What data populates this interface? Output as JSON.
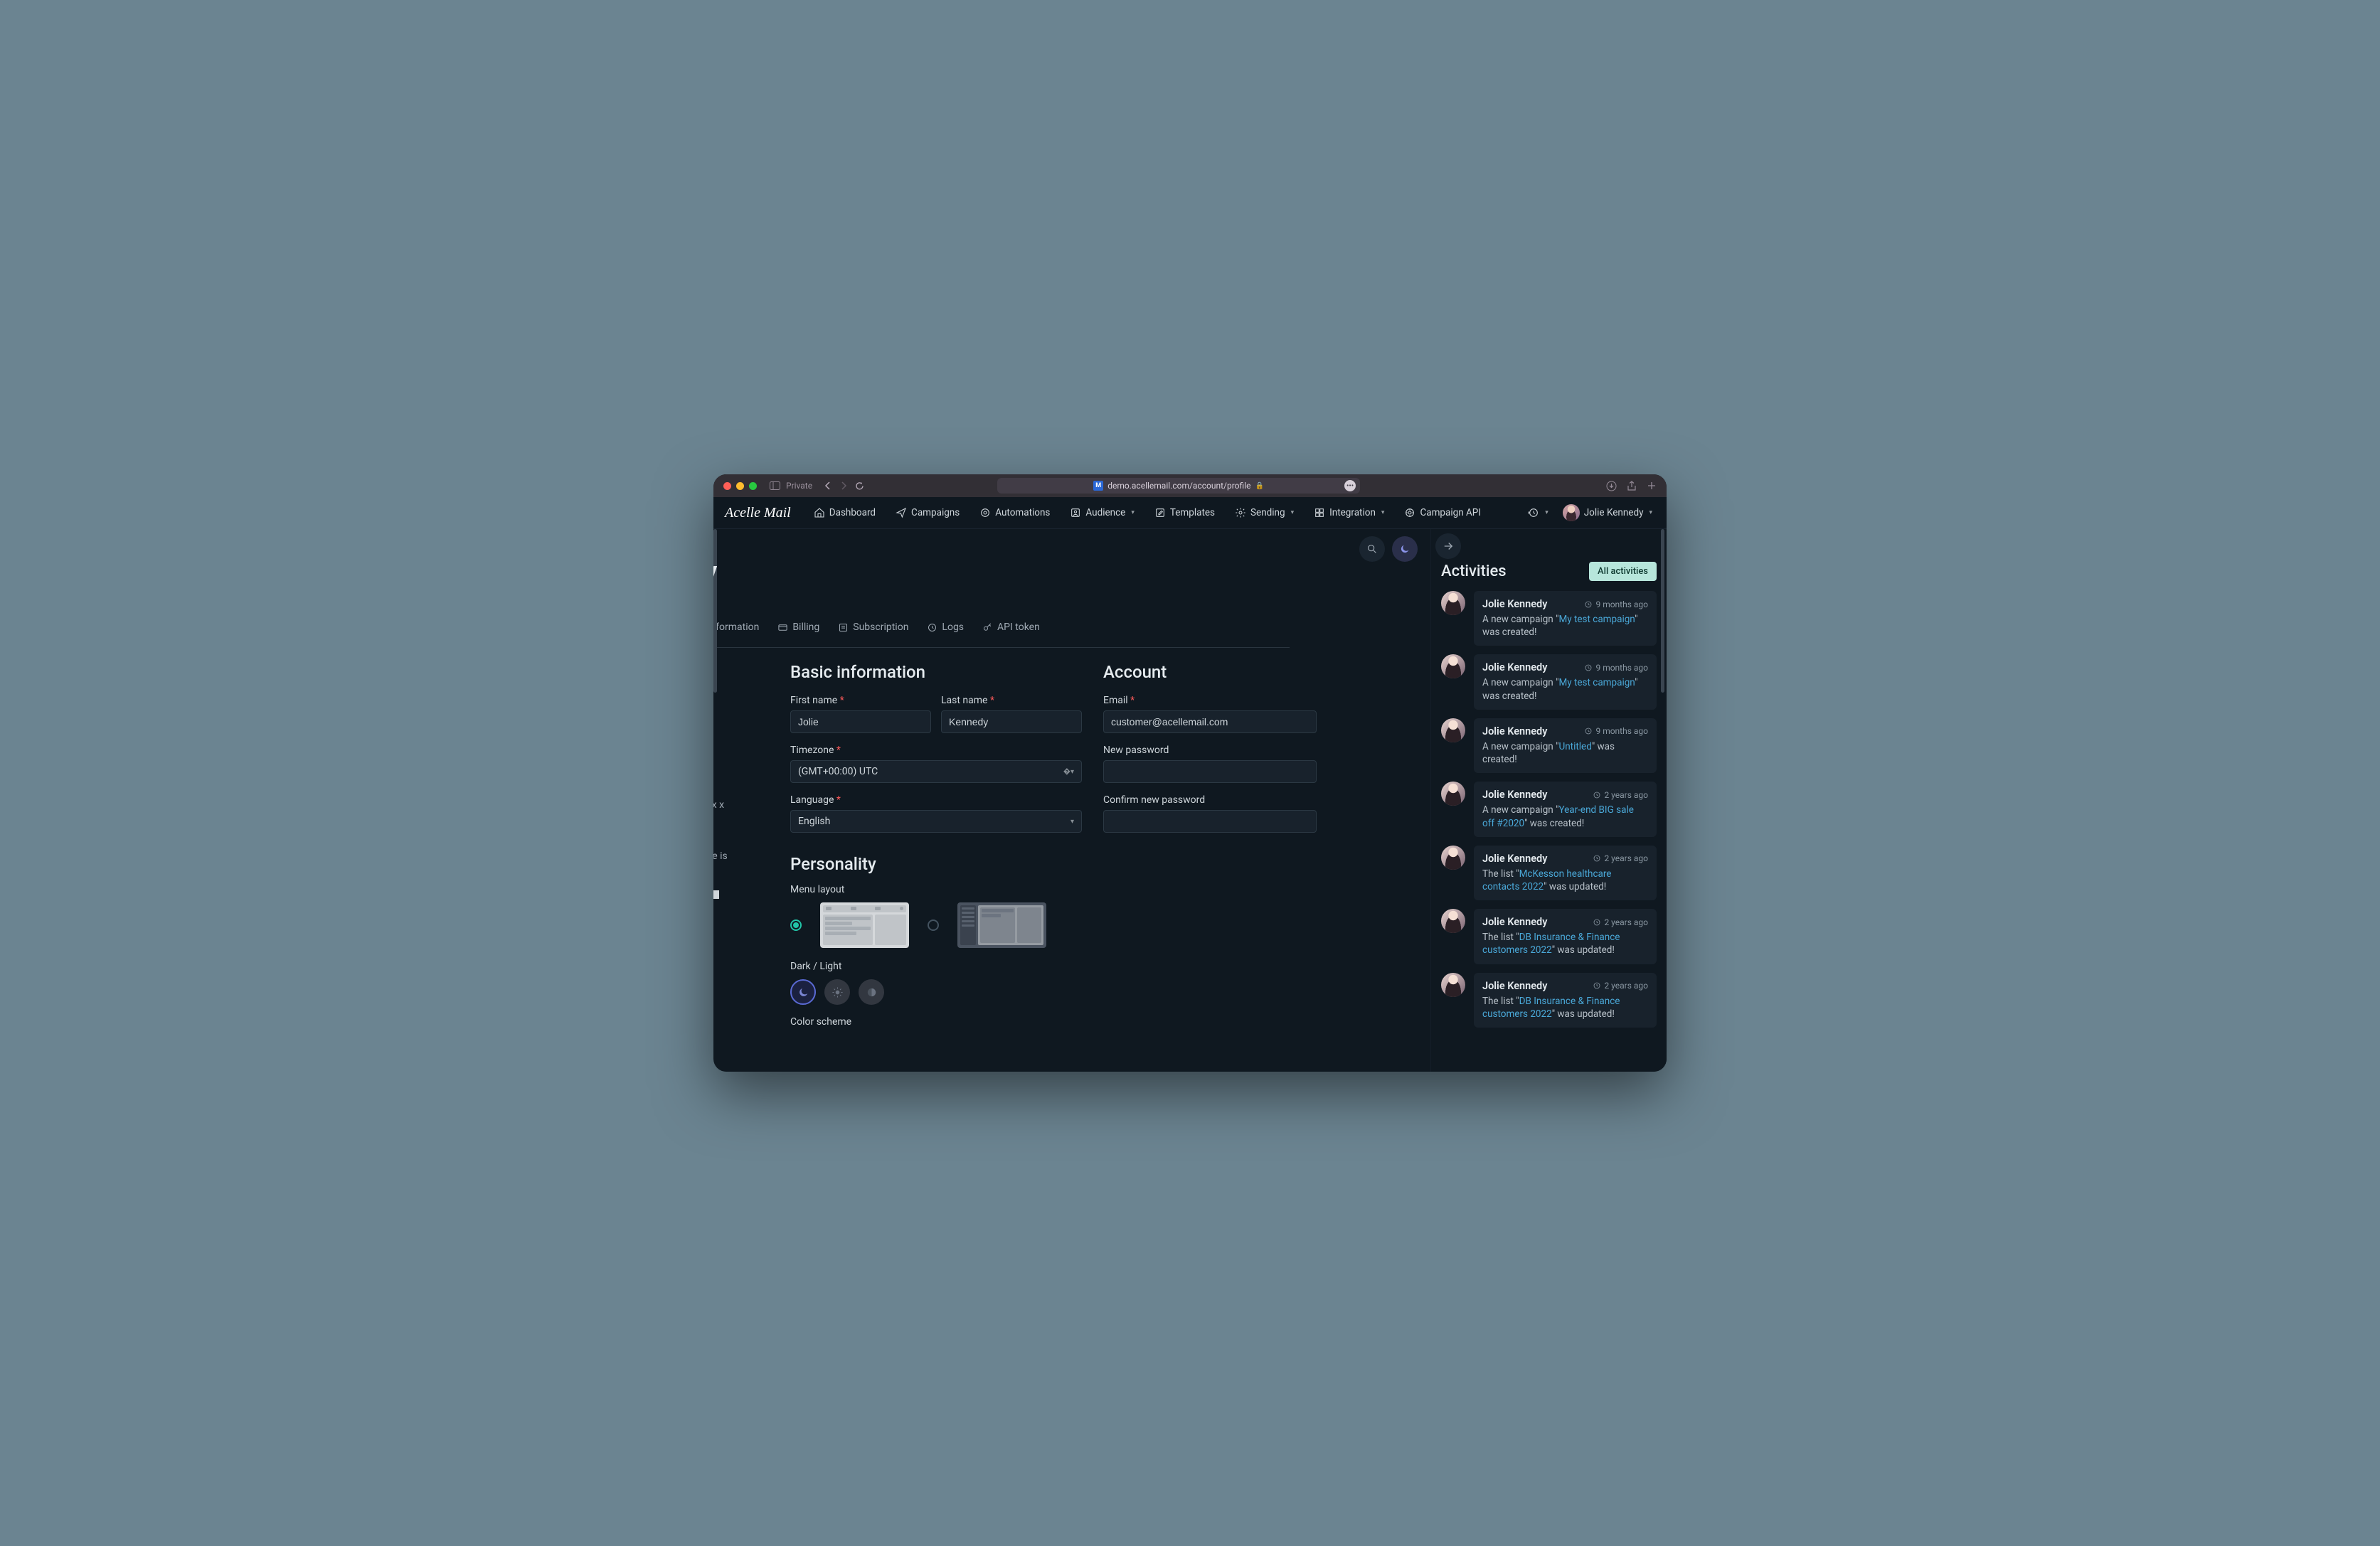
{
  "browser": {
    "private_label": "Private",
    "url": "demo.acellemail.com/account/profile",
    "favicon_letter": "M"
  },
  "brand": {
    "name": "Acelle",
    "suffix": "Mail"
  },
  "nav": {
    "dashboard": "Dashboard",
    "campaigns": "Campaigns",
    "automations": "Automations",
    "audience": "Audience",
    "templates": "Templates",
    "sending": "Sending",
    "integration": "Integration",
    "campaign_api": "Campaign API"
  },
  "user": {
    "name": "Jolie Kennedy"
  },
  "page": {
    "partial_title": "edy"
  },
  "tabs": {
    "information": "information",
    "billing": "Billing",
    "subscription": "Subscription",
    "logs": "Logs",
    "api_token": "API token"
  },
  "form": {
    "basic_heading": "Basic information",
    "account_heading": "Account",
    "first_name_label": "First name",
    "first_name_value": "Jolie",
    "last_name_label": "Last name",
    "last_name_value": "Kennedy",
    "timezone_label": "Timezone",
    "timezone_value": "(GMT+00:00) UTC",
    "language_label": "Language",
    "language_value": "English",
    "email_label": "Email",
    "email_value": "customer@acellemail.com",
    "new_password_label": "New password",
    "confirm_password_label": "Confirm new password"
  },
  "cropped": {
    "px_x": "px x",
    "ize_is": "ize is"
  },
  "personality": {
    "heading": "Personality",
    "menu_layout_label": "Menu layout",
    "dark_light_label": "Dark / Light",
    "color_scheme_label": "Color scheme"
  },
  "activities": {
    "heading": "Activities",
    "all_button": "All activities",
    "items": [
      {
        "name": "Jolie Kennedy",
        "time": "9 months ago",
        "prefix": "A new campaign \"",
        "link": "My test campaign",
        "suffix": "\" was created!"
      },
      {
        "name": "Jolie Kennedy",
        "time": "9 months ago",
        "prefix": "A new campaign \"",
        "link": "My test campaign",
        "suffix": "\" was created!"
      },
      {
        "name": "Jolie Kennedy",
        "time": "9 months ago",
        "prefix": "A new campaign \"",
        "link": "Untitled",
        "suffix": "\" was created!"
      },
      {
        "name": "Jolie Kennedy",
        "time": "2 years ago",
        "prefix": "A new campaign \"",
        "link": "Year-end BIG sale off #2020",
        "suffix": "\" was created!"
      },
      {
        "name": "Jolie Kennedy",
        "time": "2 years ago",
        "prefix": "The list \"",
        "link": "McKesson healthcare contacts 2022",
        "suffix": "\" was updated!"
      },
      {
        "name": "Jolie Kennedy",
        "time": "2 years ago",
        "prefix": "The list \"",
        "link": "DB Insurance & Finance customers 2022",
        "suffix": "\" was updated!"
      },
      {
        "name": "Jolie Kennedy",
        "time": "2 years ago",
        "prefix": "The list \"",
        "link": "DB Insurance & Finance customers 2022",
        "suffix": "\" was updated!"
      }
    ]
  }
}
